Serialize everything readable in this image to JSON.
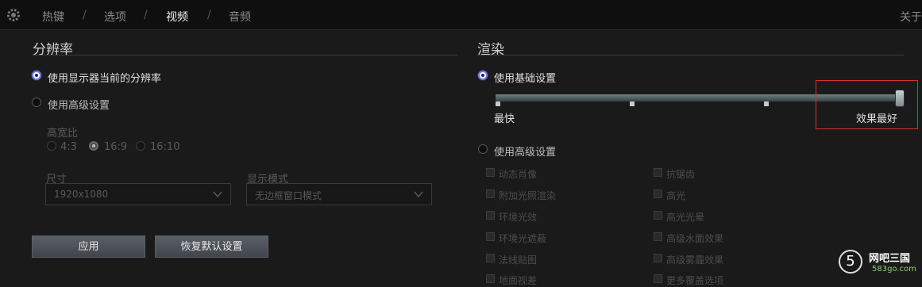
{
  "topbar": {
    "tabs": [
      {
        "label": "热键"
      },
      {
        "label": "选项"
      },
      {
        "label": "视频"
      },
      {
        "label": "音频"
      }
    ],
    "separator": "/",
    "right_label": "关于"
  },
  "resolution": {
    "title": "分辨率",
    "use_monitor": "使用显示器当前的分辨率",
    "use_advanced": "使用高级设置",
    "aspect_label": "高宽比",
    "aspect_options": [
      "4:3",
      "16:9",
      "16:10"
    ],
    "aspect_selected": "16:9",
    "size_label": "尺寸",
    "size_value": "1920x1080",
    "display_mode_label": "显示模式",
    "display_mode_value": "无边框窗口模式",
    "apply_button": "应用",
    "reset_button": "恢复默认设置"
  },
  "render": {
    "title": "渲染",
    "use_basic": "使用基础设置",
    "slider_min_label": "最快",
    "slider_max_label": "效果最好",
    "slider_value": 1.0,
    "use_advanced": "使用高级设置",
    "options_left": [
      "动态肖像",
      "附加光照渲染",
      "环境光效",
      "环境光遮蔽",
      "法线贴图",
      "地面视差"
    ],
    "options_right": [
      "抗锯齿",
      "高光",
      "高光光晕",
      "高级水面效果",
      "高级雾霾效果",
      "更多覆盖选项"
    ]
  },
  "watermark": {
    "ring_char": "5",
    "name": "网吧三国",
    "url": "583go.com"
  },
  "colors": {
    "accent_radio": "#6f7cf0",
    "highlight_box": "#d9322b"
  }
}
